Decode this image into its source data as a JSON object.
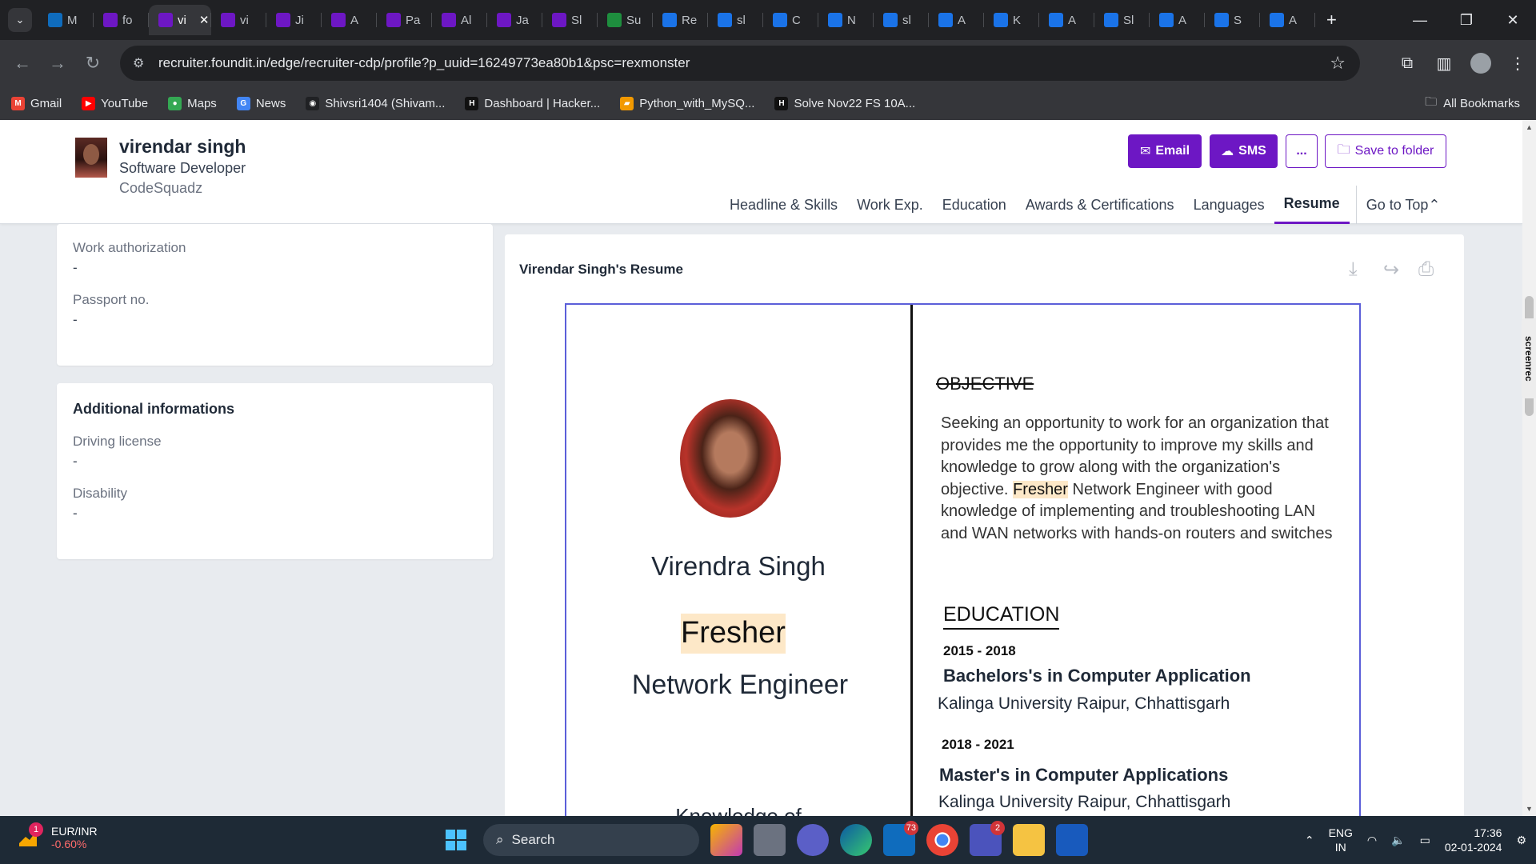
{
  "browser": {
    "tabs": [
      {
        "label": "M",
        "color": "#0f6cbd"
      },
      {
        "label": "fo",
        "color": "#6d17c4"
      },
      {
        "label": "vi",
        "color": "#6d17c4",
        "active": true
      },
      {
        "label": "vi",
        "color": "#6d17c4"
      },
      {
        "label": "Ji",
        "color": "#6d17c4"
      },
      {
        "label": "A",
        "color": "#6d17c4"
      },
      {
        "label": "Pa",
        "color": "#6d17c4"
      },
      {
        "label": "Al",
        "color": "#6d17c4"
      },
      {
        "label": "Ja",
        "color": "#6d17c4"
      },
      {
        "label": "Sl",
        "color": "#6d17c4"
      },
      {
        "label": "Su",
        "color": "#1e8e3e"
      },
      {
        "label": "Re",
        "color": "#1a73e8"
      },
      {
        "label": "sl",
        "color": "#1a73e8"
      },
      {
        "label": "C",
        "color": "#1a73e8"
      },
      {
        "label": "N",
        "color": "#1a73e8"
      },
      {
        "label": "sl",
        "color": "#1a73e8"
      },
      {
        "label": "A",
        "color": "#1a73e8"
      },
      {
        "label": "K",
        "color": "#1a73e8"
      },
      {
        "label": "A",
        "color": "#1a73e8"
      },
      {
        "label": "Sl",
        "color": "#1a73e8"
      },
      {
        "label": "A",
        "color": "#1a73e8"
      },
      {
        "label": "S",
        "color": "#1a73e8"
      },
      {
        "label": "A",
        "color": "#1a73e8"
      }
    ],
    "url": "recruiter.foundit.in/edge/recruiter-cdp/profile?p_uuid=16249773ea80b1&psc=rexmonster",
    "bookmarks": [
      {
        "label": "Gmail",
        "icon": "gmail-icon",
        "color": "#ea4335",
        "glyph": "M"
      },
      {
        "label": "YouTube",
        "icon": "youtube-icon",
        "color": "#ff0000",
        "glyph": "▶"
      },
      {
        "label": "Maps",
        "icon": "maps-icon",
        "color": "#34a853",
        "glyph": "●"
      },
      {
        "label": "News",
        "icon": "news-icon",
        "color": "#4285f4",
        "glyph": "G"
      },
      {
        "label": "Shivsri1404 (Shivam...",
        "icon": "github-icon",
        "color": "#202124",
        "glyph": "◉"
      },
      {
        "label": "Dashboard | Hacker...",
        "icon": "hackerrank-icon",
        "color": "#111",
        "glyph": "H"
      },
      {
        "label": "Python_with_MySQ...",
        "icon": "folder-doc-icon",
        "color": "#f29900",
        "glyph": "▰"
      },
      {
        "label": "Solve Nov22 FS 10A...",
        "icon": "hackerrank-icon",
        "color": "#111",
        "glyph": "H"
      }
    ],
    "all_bookmarks": "All Bookmarks"
  },
  "profile": {
    "name": "virendar singh",
    "role": "Software Developer",
    "company": "CodeSquadz",
    "actions": {
      "email": "Email",
      "sms": "SMS",
      "more": "...",
      "save": "Save to folder"
    },
    "nav": [
      "Headline & Skills",
      "Work Exp.",
      "Education",
      "Awards & Certifications",
      "Languages",
      "Resume",
      "Go to Top"
    ],
    "active_nav": "Resume"
  },
  "left": {
    "work_authorization": {
      "label": "Work authorization",
      "value": "-"
    },
    "passport": {
      "label": "Passport no.",
      "value": "-"
    },
    "additional_title": "Additional informations",
    "driving_license": {
      "label": "Driving license",
      "value": "-"
    },
    "disability": {
      "label": "Disability",
      "value": "-"
    }
  },
  "resume": {
    "panel_title": "Virendar Singh's Resume",
    "name": "Virendra Singh",
    "status": "Fresher",
    "title": "Network Engineer",
    "knowledge_heading": "Knowledge of",
    "objective_heading": "OBJECTIVE",
    "objective_before": "Seeking an opportunity to work for an organization that provides me the opportunity to improve my skills and knowledge to grow along with the organization's objective. ",
    "objective_highlight": "Fresher",
    "objective_after": " Network Engineer with good knowledge of implementing and troubleshooting LAN and WAN networks with hands-on routers and switches",
    "education_heading": "EDUCATION",
    "education": [
      {
        "years": "2015 - 2018",
        "degree": "Bachelors's in Computer Application",
        "university": "Kalinga University Raipur, Chhattisgarh"
      },
      {
        "years": "2018 - 2021",
        "degree": "Master's in Computer Applications",
        "university": "Kalinga University Raipur, Chhattisgarh"
      }
    ]
  },
  "side_widget": "screenrec",
  "taskbar": {
    "stock_name": "EUR/INR",
    "stock_change": "-0.60%",
    "stock_badge": "1",
    "search": "Search",
    "mail_badge": "73",
    "teams_badge": "2",
    "lang_1": "ENG",
    "lang_2": "IN",
    "time": "17:36",
    "date": "02-01-2024"
  }
}
